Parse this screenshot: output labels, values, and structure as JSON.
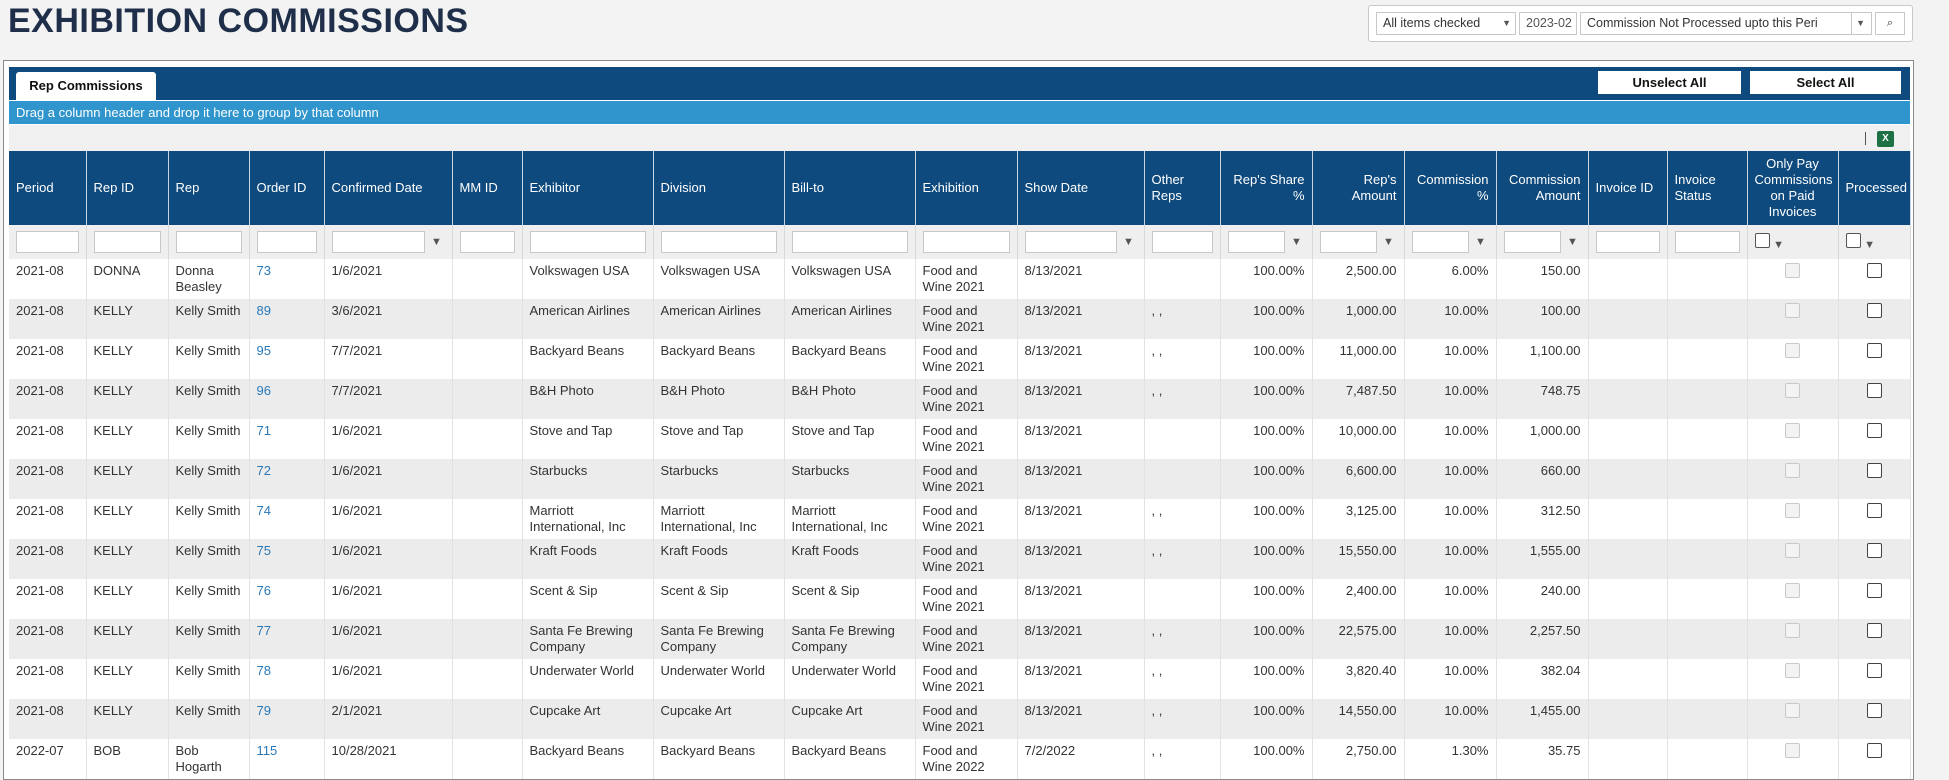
{
  "page": {
    "title": "EXHIBITION COMMISSIONS"
  },
  "filters": {
    "items_checked": "All items checked",
    "period": "2023-02",
    "status": "Commission Not Processed upto this Peri"
  },
  "tabs": {
    "rep_commissions": "Rep Commissions"
  },
  "toolbar": {
    "unselect_all": "Unselect All",
    "select_all": "Select All",
    "excel": "X"
  },
  "group_bar": {
    "text": "Drag a column header and drop it here to group by that column"
  },
  "columns": [
    "Period",
    "Rep ID",
    "Rep",
    "Order ID",
    "Confirmed Date",
    "MM ID",
    "Exhibitor",
    "Division",
    "Bill-to",
    "Exhibition",
    "Show Date",
    "Other Reps",
    "Rep's Share %",
    "Rep's Amount",
    "Commission %",
    "Commission Amount",
    "Invoice ID",
    "Invoice Status",
    "Only Pay Commissions on Paid Invoices",
    "Processed"
  ],
  "rows": [
    {
      "period": "2021-08",
      "rep_id": "DONNA",
      "rep": "Donna Beasley",
      "order_id": "73",
      "confirmed": "1/6/2021",
      "mm_id": "",
      "exhibitor": "Volkswagen USA",
      "division": "Volkswagen USA",
      "bill_to": "Volkswagen USA",
      "exhibition": "Food and Wine 2021",
      "show_date": "8/13/2021",
      "other_reps": "",
      "share": "100.00%",
      "rep_amount": "2,500.00",
      "comm_pct": "6.00%",
      "comm_amt": "150.00",
      "invoice_id": "",
      "invoice_status": ""
    },
    {
      "period": "2021-08",
      "rep_id": "KELLY",
      "rep": "Kelly Smith",
      "order_id": "89",
      "confirmed": "3/6/2021",
      "mm_id": "",
      "exhibitor": "American Airlines",
      "division": "American Airlines",
      "bill_to": "American Airlines",
      "exhibition": "Food and Wine 2021",
      "show_date": "8/13/2021",
      "other_reps": ", ,",
      "share": "100.00%",
      "rep_amount": "1,000.00",
      "comm_pct": "10.00%",
      "comm_amt": "100.00",
      "invoice_id": "",
      "invoice_status": ""
    },
    {
      "period": "2021-08",
      "rep_id": "KELLY",
      "rep": "Kelly Smith",
      "order_id": "95",
      "confirmed": "7/7/2021",
      "mm_id": "",
      "exhibitor": "Backyard Beans",
      "division": "Backyard Beans",
      "bill_to": "Backyard Beans",
      "exhibition": "Food and Wine 2021",
      "show_date": "8/13/2021",
      "other_reps": ", ,",
      "share": "100.00%",
      "rep_amount": "11,000.00",
      "comm_pct": "10.00%",
      "comm_amt": "1,100.00",
      "invoice_id": "",
      "invoice_status": ""
    },
    {
      "period": "2021-08",
      "rep_id": "KELLY",
      "rep": "Kelly Smith",
      "order_id": "96",
      "confirmed": "7/7/2021",
      "mm_id": "",
      "exhibitor": "B&H Photo",
      "division": "B&H Photo",
      "bill_to": "B&H Photo",
      "exhibition": "Food and Wine 2021",
      "show_date": "8/13/2021",
      "other_reps": ", ,",
      "share": "100.00%",
      "rep_amount": "7,487.50",
      "comm_pct": "10.00%",
      "comm_amt": "748.75",
      "invoice_id": "",
      "invoice_status": ""
    },
    {
      "period": "2021-08",
      "rep_id": "KELLY",
      "rep": "Kelly Smith",
      "order_id": "71",
      "confirmed": "1/6/2021",
      "mm_id": "",
      "exhibitor": "Stove and Tap",
      "division": "Stove and Tap",
      "bill_to": "Stove and Tap",
      "exhibition": "Food and Wine 2021",
      "show_date": "8/13/2021",
      "other_reps": "",
      "share": "100.00%",
      "rep_amount": "10,000.00",
      "comm_pct": "10.00%",
      "comm_amt": "1,000.00",
      "invoice_id": "",
      "invoice_status": ""
    },
    {
      "period": "2021-08",
      "rep_id": "KELLY",
      "rep": "Kelly Smith",
      "order_id": "72",
      "confirmed": "1/6/2021",
      "mm_id": "",
      "exhibitor": "Starbucks",
      "division": "Starbucks",
      "bill_to": "Starbucks",
      "exhibition": "Food and Wine 2021",
      "show_date": "8/13/2021",
      "other_reps": "",
      "share": "100.00%",
      "rep_amount": "6,600.00",
      "comm_pct": "10.00%",
      "comm_amt": "660.00",
      "invoice_id": "",
      "invoice_status": ""
    },
    {
      "period": "2021-08",
      "rep_id": "KELLY",
      "rep": "Kelly Smith",
      "order_id": "74",
      "confirmed": "1/6/2021",
      "mm_id": "",
      "exhibitor": "Marriott International, Inc",
      "division": "Marriott International, Inc",
      "bill_to": "Marriott International, Inc",
      "exhibition": "Food and Wine 2021",
      "show_date": "8/13/2021",
      "other_reps": ", ,",
      "share": "100.00%",
      "rep_amount": "3,125.00",
      "comm_pct": "10.00%",
      "comm_amt": "312.50",
      "invoice_id": "",
      "invoice_status": ""
    },
    {
      "period": "2021-08",
      "rep_id": "KELLY",
      "rep": "Kelly Smith",
      "order_id": "75",
      "confirmed": "1/6/2021",
      "mm_id": "",
      "exhibitor": "Kraft Foods",
      "division": "Kraft Foods",
      "bill_to": "Kraft Foods",
      "exhibition": "Food and Wine 2021",
      "show_date": "8/13/2021",
      "other_reps": ", ,",
      "share": "100.00%",
      "rep_amount": "15,550.00",
      "comm_pct": "10.00%",
      "comm_amt": "1,555.00",
      "invoice_id": "",
      "invoice_status": ""
    },
    {
      "period": "2021-08",
      "rep_id": "KELLY",
      "rep": "Kelly Smith",
      "order_id": "76",
      "confirmed": "1/6/2021",
      "mm_id": "",
      "exhibitor": "Scent & Sip",
      "division": "Scent & Sip",
      "bill_to": "Scent & Sip",
      "exhibition": "Food and Wine 2021",
      "show_date": "8/13/2021",
      "other_reps": "",
      "share": "100.00%",
      "rep_amount": "2,400.00",
      "comm_pct": "10.00%",
      "comm_amt": "240.00",
      "invoice_id": "",
      "invoice_status": ""
    },
    {
      "period": "2021-08",
      "rep_id": "KELLY",
      "rep": "Kelly Smith",
      "order_id": "77",
      "confirmed": "1/6/2021",
      "mm_id": "",
      "exhibitor": "Santa Fe Brewing Company",
      "division": "Santa Fe Brewing Company",
      "bill_to": "Santa Fe Brewing Company",
      "exhibition": "Food and Wine 2021",
      "show_date": "8/13/2021",
      "other_reps": ", ,",
      "share": "100.00%",
      "rep_amount": "22,575.00",
      "comm_pct": "10.00%",
      "comm_amt": "2,257.50",
      "invoice_id": "",
      "invoice_status": ""
    },
    {
      "period": "2021-08",
      "rep_id": "KELLY",
      "rep": "Kelly Smith",
      "order_id": "78",
      "confirmed": "1/6/2021",
      "mm_id": "",
      "exhibitor": "Underwater World",
      "division": "Underwater World",
      "bill_to": "Underwater World",
      "exhibition": "Food and Wine 2021",
      "show_date": "8/13/2021",
      "other_reps": ", ,",
      "share": "100.00%",
      "rep_amount": "3,820.40",
      "comm_pct": "10.00%",
      "comm_amt": "382.04",
      "invoice_id": "",
      "invoice_status": ""
    },
    {
      "period": "2021-08",
      "rep_id": "KELLY",
      "rep": "Kelly Smith",
      "order_id": "79",
      "confirmed": "2/1/2021",
      "mm_id": "",
      "exhibitor": "Cupcake Art",
      "division": "Cupcake Art",
      "bill_to": "Cupcake Art",
      "exhibition": "Food and Wine 2021",
      "show_date": "8/13/2021",
      "other_reps": ", ,",
      "share": "100.00%",
      "rep_amount": "14,550.00",
      "comm_pct": "10.00%",
      "comm_amt": "1,455.00",
      "invoice_id": "",
      "invoice_status": ""
    },
    {
      "period": "2022-07",
      "rep_id": "BOB",
      "rep": "Bob Hogarth",
      "order_id": "115",
      "confirmed": "10/28/2021",
      "mm_id": "",
      "exhibitor": "Backyard Beans",
      "division": "Backyard Beans",
      "bill_to": "Backyard Beans",
      "exhibition": "Food and Wine 2022",
      "show_date": "7/2/2022",
      "other_reps": ", ,",
      "share": "100.00%",
      "rep_amount": "2,750.00",
      "comm_pct": "1.30%",
      "comm_amt": "35.75",
      "invoice_id": "",
      "invoice_status": ""
    }
  ]
}
